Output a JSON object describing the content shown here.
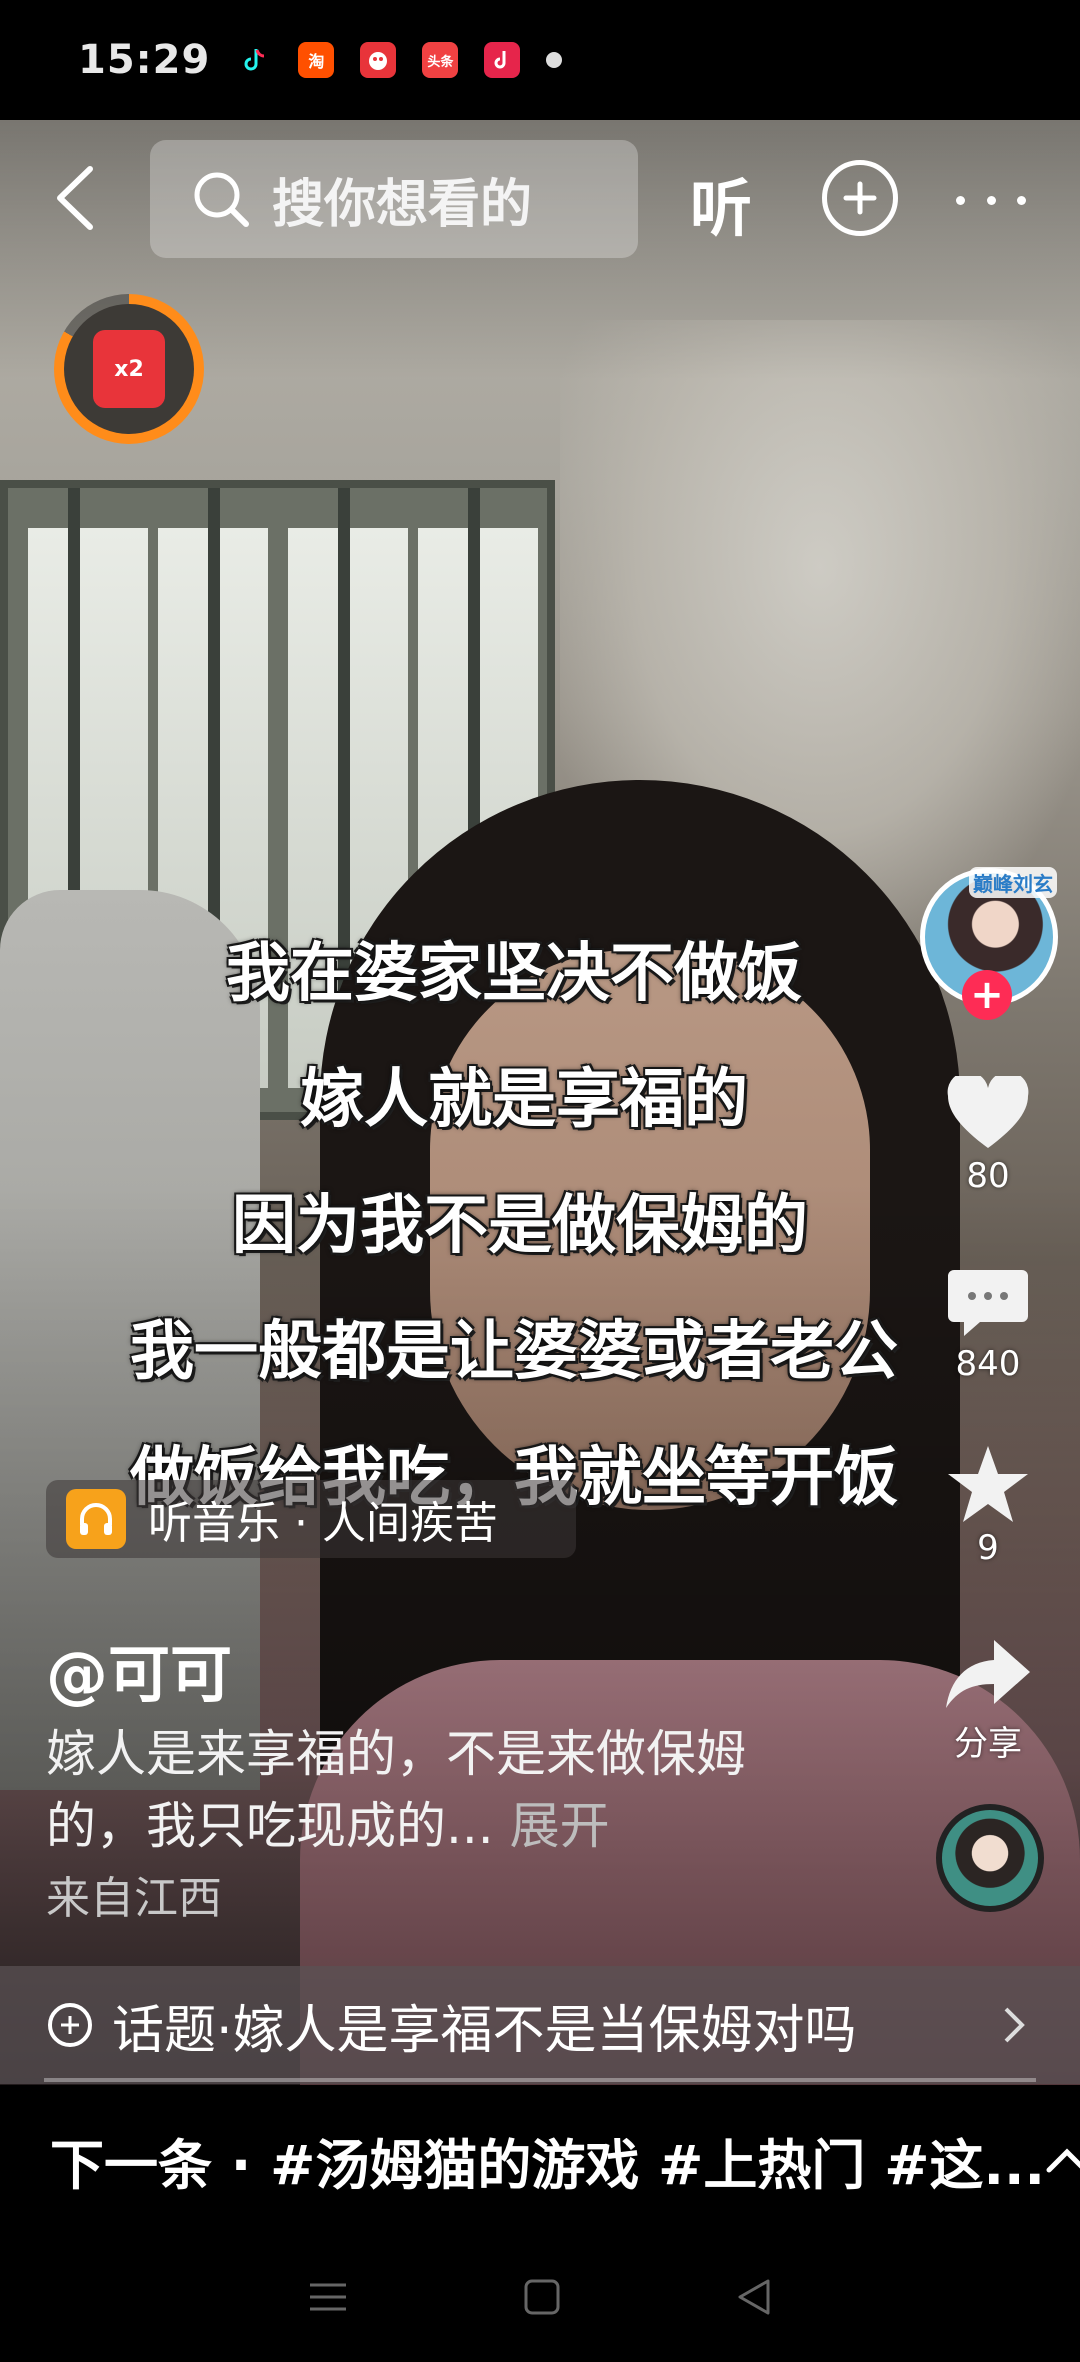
{
  "status_bar": {
    "time": "15:29",
    "notification_icons": [
      {
        "name": "douyin-icon",
        "color": "#000000"
      },
      {
        "name": "taobao-icon",
        "label": "淘",
        "color": "#ff5000"
      },
      {
        "name": "app-icon",
        "color": "#e8343a"
      },
      {
        "name": "toutiao-icon",
        "label": "头条",
        "color": "#f04142"
      },
      {
        "name": "douyin-lite-icon",
        "color": "#e6254b"
      }
    ]
  },
  "top_nav": {
    "search_placeholder": "搜你想看的",
    "listen_label": "听"
  },
  "reward_badge": {
    "label": "x2",
    "progress": 0.83
  },
  "subtitles": [
    "我在婆家坚决不做饭",
    "嫁人就是享福的",
    "因为我不是做保姆的",
    "我一般都是让婆婆或者老公",
    "做饭给我吃，我就坐等开饭"
  ],
  "right_rail": {
    "avatar_badge": "巅峰刘玄",
    "follow_symbol": "+",
    "like_count": "80",
    "comment_count": "840",
    "favorite_count": "9",
    "share_label": "分享"
  },
  "post": {
    "music": "听音乐 · 人间疾苦",
    "author": "@可可",
    "description": "嫁人是来享福的，不是来做保姆的，我只吃现成的...",
    "expand_label": "展开",
    "location": "来自江西"
  },
  "topic": {
    "label": "话题·嫁人是享福不是当保姆对吗"
  },
  "next_bar": {
    "label": "下一条 · #汤姆猫的游戏 #上热门 #这..."
  }
}
